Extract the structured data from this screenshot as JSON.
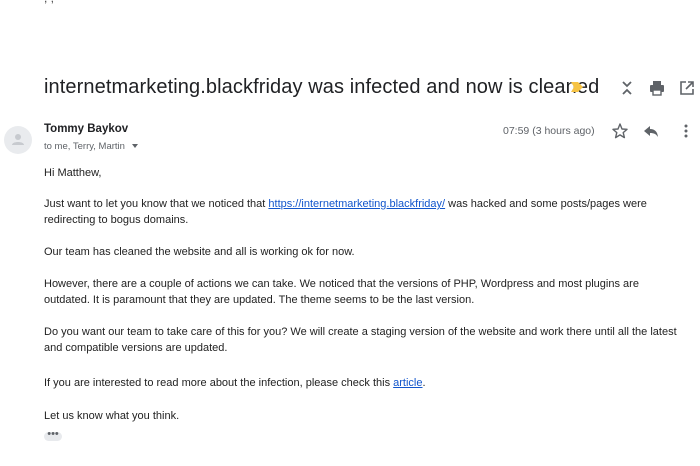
{
  "top_crop_text": ", ,",
  "email": {
    "subject": "internetmarketing.blackfriday was infected and now is cleaned",
    "sender_name": "Tommy Baykov",
    "recipients": "to me, Terry, Martin",
    "timestamp": "07:59 (3 hours ago)",
    "greeting": "Hi Matthew,",
    "p1_before": "Just want to let you know that we noticed that ",
    "p1_link": "https://internetmarketing.blackfriday/",
    "p1_after": " was hacked and some posts/pages were redirecting to bogus domains.",
    "p2": "Our team has cleaned the website and all is working ok for now.",
    "p3": "However, there are a couple of actions we can take. We noticed that the versions of PHP, Wordpress and most plugins are outdated. It is paramount that they are updated. The theme seems to be the last version.",
    "p4": "Do you want our team to take care of this for you? We will create a staging version of the website and work there until all the latest and compatible versions are updated.",
    "p5_before": "If you are interested to read more about the infection, please check this ",
    "p5_link": "article",
    "p5_after": ".",
    "p6": "Let us know what you think.",
    "trimmed_content": "•••"
  },
  "icons": {
    "label": "importance-marker-icon",
    "expand": "expand-collapse-icon",
    "print": "print-icon",
    "new_window": "open-in-new-window-icon",
    "avatar": "default-avatar-icon",
    "star": "star-icon",
    "reply": "reply-icon",
    "more": "more-vert-icon",
    "caret": "chevron-down-icon"
  },
  "colors": {
    "link": "#1155cc",
    "importance_marker": "#f6c344",
    "icon_gray": "#5f6368"
  }
}
